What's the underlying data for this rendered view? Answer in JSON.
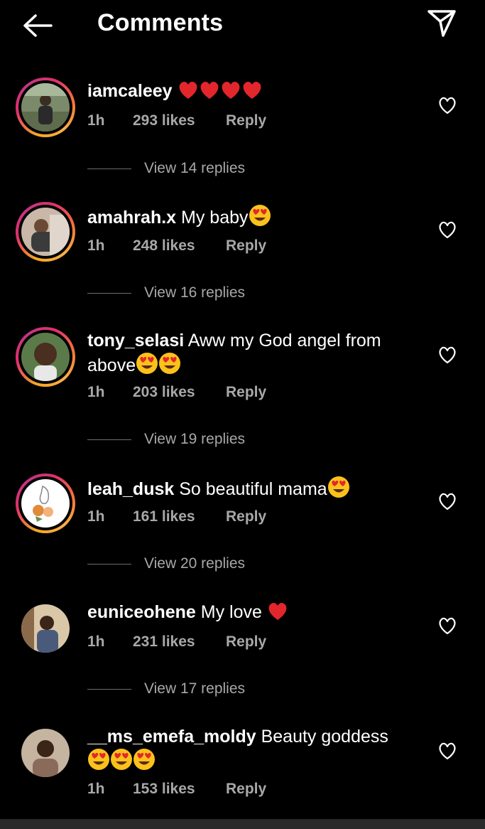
{
  "header": {
    "title": "Comments",
    "back_icon": "arrow-left-icon",
    "share_icon": "send-icon"
  },
  "colors": {
    "background": "#000000",
    "text": "#ffffff",
    "muted": "#a8a8a8",
    "heart_red": "#e3262c",
    "ring_start": "#f5a623",
    "ring_end": "#c13584"
  },
  "comments": [
    {
      "username": "iamcaleey",
      "text": "",
      "emojis": [
        "heart",
        "heart",
        "heart",
        "heart"
      ],
      "time": "1h",
      "likes": "293 likes",
      "reply": "Reply",
      "replies": "View 14 replies",
      "story_ring": true
    },
    {
      "username": "amahrah.x",
      "text": "My baby",
      "emojis": [
        "heart-eyes"
      ],
      "time": "1h",
      "likes": "248 likes",
      "reply": "Reply",
      "replies": "View 16 replies",
      "story_ring": true
    },
    {
      "username": "tony_selasi",
      "text": "Aww my God angel from above",
      "emojis": [
        "heart-eyes",
        "heart-eyes"
      ],
      "time": "1h",
      "likes": "203 likes",
      "reply": "Reply",
      "replies": "View 19 replies",
      "story_ring": true
    },
    {
      "username": "leah_dusk",
      "text": "So beautiful mama",
      "emojis": [
        "heart-eyes"
      ],
      "time": "1h",
      "likes": "161 likes",
      "reply": "Reply",
      "replies": "View 20 replies",
      "story_ring": true
    },
    {
      "username": "euniceohene",
      "text": "My love",
      "emojis": [
        "heart"
      ],
      "time": "1h",
      "likes": "231 likes",
      "reply": "Reply",
      "replies": "View 17 replies",
      "story_ring": false
    },
    {
      "username": "__ms_emefa_moldy",
      "text": "Beauty goddess",
      "emojis": [
        "heart-eyes",
        "heart-eyes",
        "heart-eyes"
      ],
      "time": "1h",
      "likes": "153 likes",
      "reply": "Reply",
      "replies": "",
      "story_ring": false
    }
  ]
}
